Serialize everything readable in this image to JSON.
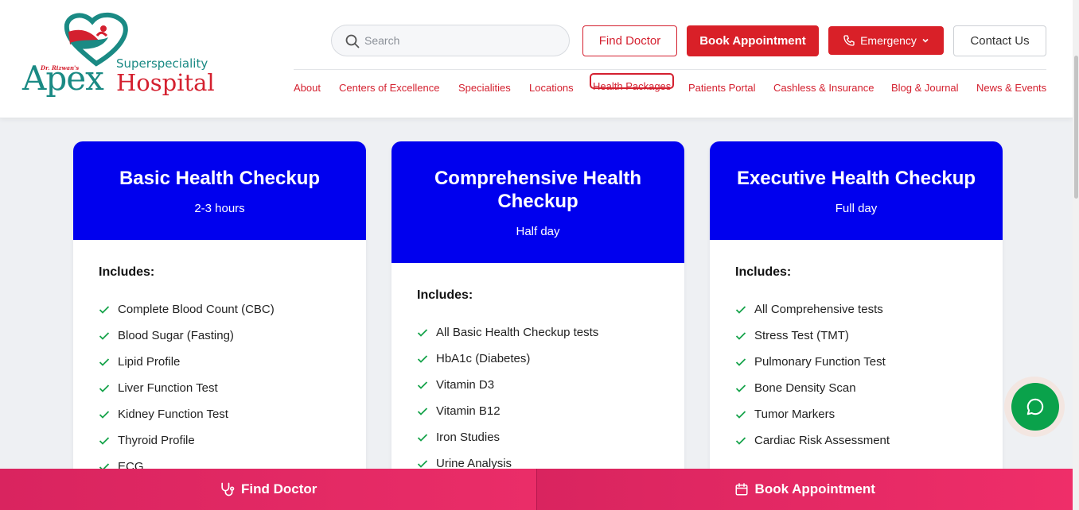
{
  "brand": {
    "dr_name": "Dr. Rizwan's",
    "super": "Superspeciality",
    "name_1": "Apex",
    "name_2": "Hospital",
    "colors": {
      "teal": "#1a8a84",
      "red": "#d4202f"
    }
  },
  "search": {
    "placeholder": "Search",
    "value": ""
  },
  "header_buttons": {
    "find_doctor": "Find Doctor",
    "book_appointment": "Book Appointment",
    "emergency": "Emergency",
    "contact_us": "Contact Us"
  },
  "nav": {
    "items": [
      "About",
      "Centers of Excellence",
      "Specialities",
      "Locations",
      "Health Packages",
      "Patients Portal",
      "Cashless & Insurance",
      "Blog & Journal",
      "News & Events"
    ],
    "active": "Health Packages"
  },
  "packages": [
    {
      "title": "Basic Health Checkup",
      "duration": "2-3 hours",
      "includes_label": "Includes:",
      "items": [
        "Complete Blood Count (CBC)",
        "Blood Sugar (Fasting)",
        "Lipid Profile",
        "Liver Function Test",
        "Kidney Function Test",
        "Thyroid Profile",
        "ECG"
      ]
    },
    {
      "title": "Comprehensive Health Checkup",
      "duration": "Half day",
      "includes_label": "Includes:",
      "items": [
        "All Basic Health Checkup tests",
        "HbA1c (Diabetes)",
        "Vitamin D3",
        "Vitamin B12",
        "Iron Studies",
        "Urine Analysis"
      ]
    },
    {
      "title": "Executive Health Checkup",
      "duration": "Full day",
      "includes_label": "Includes:",
      "items": [
        "All Comprehensive tests",
        "Stress Test (TMT)",
        "Pulmonary Function Test",
        "Bone Density Scan",
        "Tumor Markers",
        "Cardiac Risk Assessment"
      ]
    }
  ],
  "bottom_bar": {
    "find_doctor": "Find Doctor",
    "book_appointment": "Book Appointment"
  },
  "icons": {
    "search": "search-icon",
    "phone": "phone-icon",
    "chevron": "chevron-down-icon",
    "check": "check-icon",
    "chat": "chat-icon",
    "stethoscope": "stethoscope-icon",
    "calendar": "calendar-icon"
  },
  "colors": {
    "card_header": "#0000ee",
    "check": "#16a34a",
    "chat": "#0aa24b",
    "bottom_bar": "#e42a65",
    "button_red": "#d92028"
  }
}
